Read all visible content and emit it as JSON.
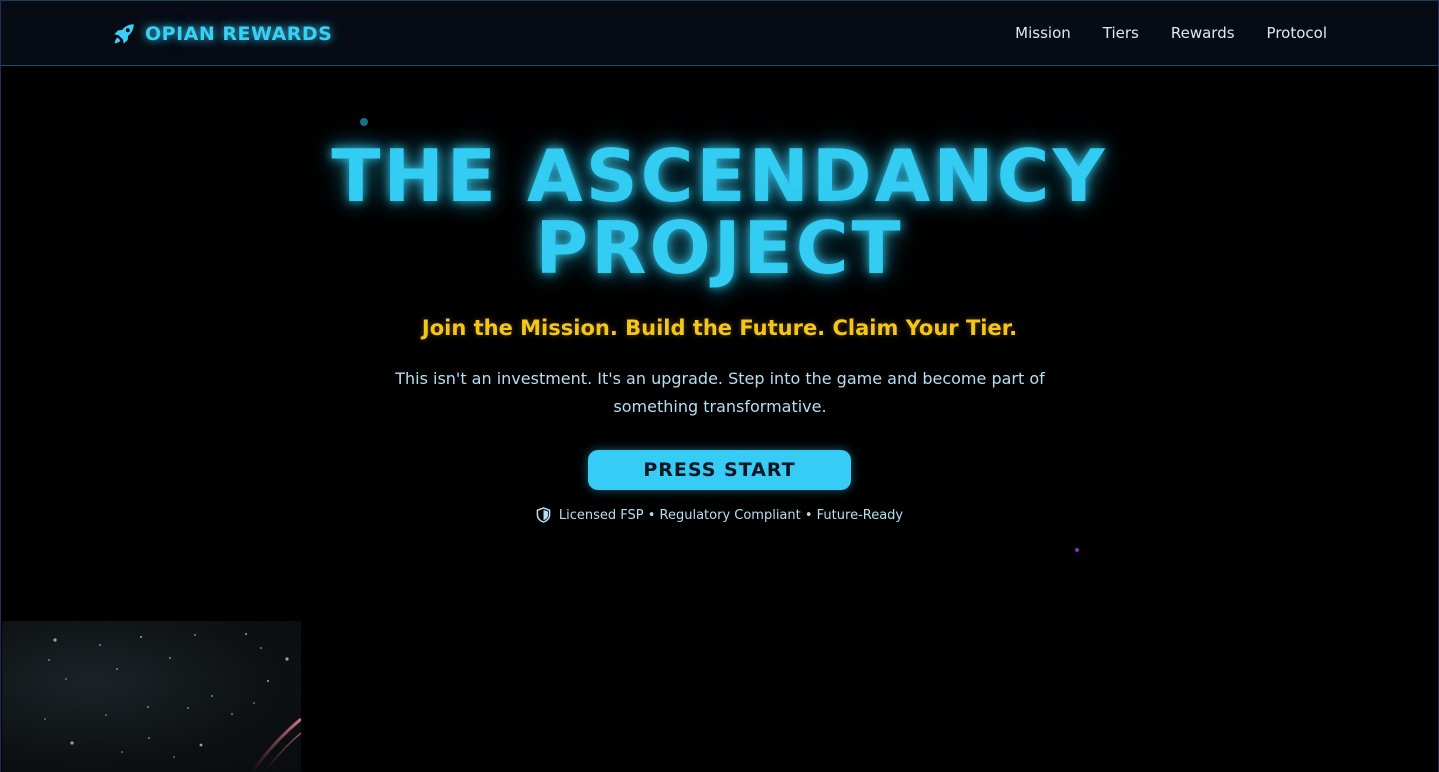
{
  "nav": {
    "brand": "OPIAN REWARDS",
    "brand_icon": "rocket-icon",
    "links": [
      "Mission",
      "Tiers",
      "Rewards",
      "Protocol"
    ]
  },
  "hero": {
    "title_line1": "THE ASCENDANCY",
    "title_line2": "PROJECT",
    "tagline": "Join the Mission. Build the Future. Claim Your Tier.",
    "subtitle_line1": "This isn't an investment. It's an upgrade. Step into the game and become part of",
    "subtitle_line2": "something transformative.",
    "cta_label": "PRESS START",
    "trust_icon": "shield-icon",
    "trust_text": "Licensed FSP • Regulatory Compliant • Future-Ready"
  },
  "colors": {
    "accent_cyan": "#36ccf5",
    "accent_yellow": "#f5c518",
    "background": "#000000",
    "nav_background": "#070b14"
  }
}
